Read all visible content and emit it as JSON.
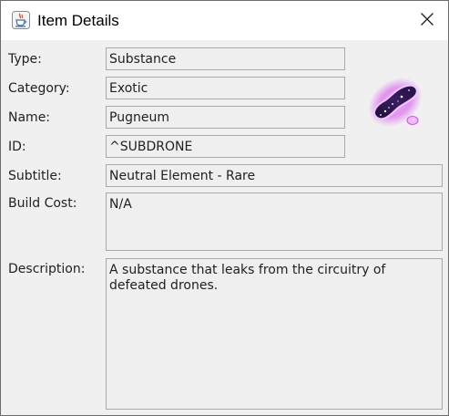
{
  "window": {
    "title": "Item Details",
    "app_icon": "java-cup-icon",
    "close_icon": "close-icon"
  },
  "form": {
    "type_label": "Type:",
    "type_value": "Substance",
    "category_label": "Category:",
    "category_value": "Exotic",
    "name_label": "Name:",
    "name_value": "Pugneum",
    "id_label": "ID:",
    "id_value": "^SUBDRONE",
    "subtitle_label": "Subtitle:",
    "subtitle_value": "Neutral Element - Rare",
    "build_cost_label": "Build Cost:",
    "build_cost_value": "N/A",
    "description_label": "Description:",
    "description_value": "A substance that leaks from the circuitry of\ndefeated drones."
  },
  "item_image": {
    "icon": "pugneum-substance-icon",
    "glow_color": "#d84cf0"
  }
}
